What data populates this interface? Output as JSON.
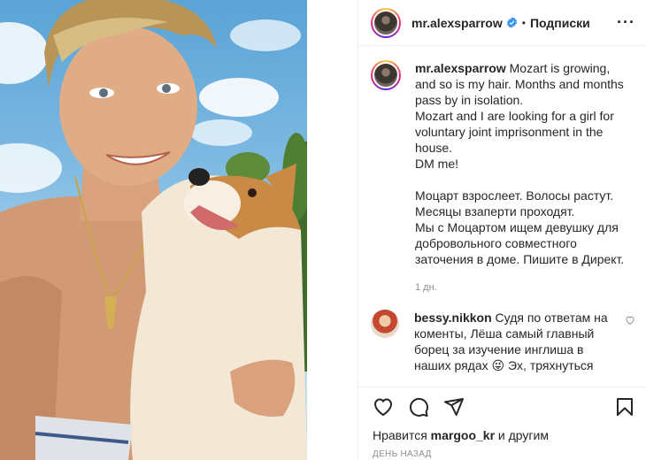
{
  "post": {
    "username": "mr.alexsparrow",
    "follow_separator": "•",
    "follow_label": "Подписки",
    "more_label": "···"
  },
  "caption": {
    "username": "mr.alexsparrow",
    "text": " Mozart is growing, and so is my hair. Months and months pass by in isolation.\nMozart and I are looking for a girl for voluntary joint imprisonment in the house.\nDM me!\n\nМоцарт взрослеет. Волосы растут. Месяцы взаперти проходят.\nМы с Моцартом ищем девушку для добровольного совместного заточения в доме. Пишите в Директ.",
    "time": "1 дн."
  },
  "comment": {
    "username": "bessy.nikkon",
    "text": " Судя по ответам на коменты, Лёша самый главный борец за изучение инглиша в наших рядах 😜 Эх, тряхнуться"
  },
  "likes": {
    "prefix": "Нравится ",
    "user": "margoo_kr",
    "suffix": " и другим"
  },
  "date": "ДЕНЬ НАЗАД",
  "icons": {
    "verified": "verified-badge-icon",
    "like": "heart-icon",
    "comment": "comment-bubble-icon",
    "share": "paper-plane-icon",
    "save": "bookmark-icon",
    "comment_like": "small-heart-icon"
  },
  "colors": {
    "verified_blue": "#3897f0",
    "text": "#262626",
    "muted": "#8e8e8e"
  }
}
